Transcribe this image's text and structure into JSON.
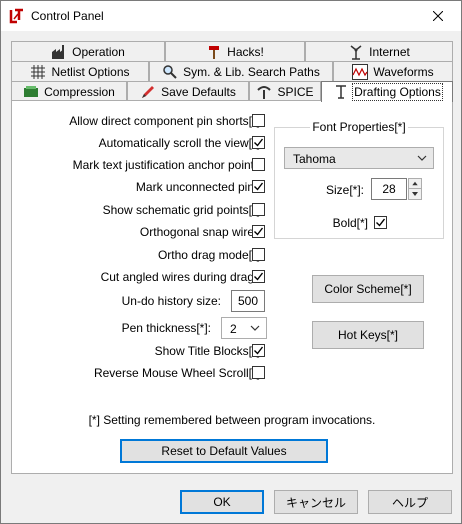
{
  "window": {
    "title": "Control Panel"
  },
  "tabs": {
    "row1": [
      {
        "label": "Operation",
        "icon": "factory-icon"
      },
      {
        "label": "Hacks!",
        "icon": "hammer-icon"
      },
      {
        "label": "Internet",
        "icon": "antenna-icon"
      }
    ],
    "row2": [
      {
        "label": "Netlist Options",
        "icon": "grid-icon"
      },
      {
        "label": "Sym. & Lib. Search Paths",
        "icon": "magnifier-icon"
      },
      {
        "label": "Waveforms",
        "icon": "waveform-icon"
      }
    ],
    "row3": [
      {
        "label": "Compression",
        "icon": "compression-icon"
      },
      {
        "label": "Save Defaults",
        "icon": "pencil-icon"
      },
      {
        "label": "SPICE",
        "icon": "spice-icon"
      },
      {
        "label": "Drafting Options",
        "icon": "drafting-icon",
        "active": true
      }
    ]
  },
  "options": [
    {
      "label": "Allow direct component pin shorts[*]",
      "checked": false
    },
    {
      "label": "Automatically scroll the view[*]",
      "checked": true
    },
    {
      "label": "Mark text justification anchor points",
      "checked": false
    },
    {
      "label": "Mark unconnected pins",
      "checked": true
    },
    {
      "label": "Show schematic grid points[*]",
      "checked": false
    },
    {
      "label": "Orthogonal snap wires",
      "checked": true
    },
    {
      "label": "Ortho drag mode[*]",
      "checked": false
    },
    {
      "label": "Cut angled wires during drags",
      "checked": true
    }
  ],
  "undo": {
    "label": "Un-do history size:",
    "value": "500"
  },
  "pen": {
    "label": "Pen thickness[*]:",
    "value": "2"
  },
  "options2": [
    {
      "label": "Show Title Blocks[*]",
      "checked": true
    },
    {
      "label": "Reverse Mouse Wheel Scroll[*]",
      "checked": false
    }
  ],
  "font": {
    "group_title": "Font Properties[*]",
    "family": "Tahoma",
    "size_label": "Size[*]:",
    "size_value": "28",
    "bold_label": "Bold[*]",
    "bold_checked": true
  },
  "buttons": {
    "color_scheme": "Color Scheme[*]",
    "hot_keys": "Hot Keys[*]",
    "reset": "Reset to Default Values"
  },
  "note": "[*] Setting remembered between program invocations.",
  "footer": {
    "ok": "OK",
    "cancel": "キャンセル",
    "help": "ヘルプ"
  }
}
